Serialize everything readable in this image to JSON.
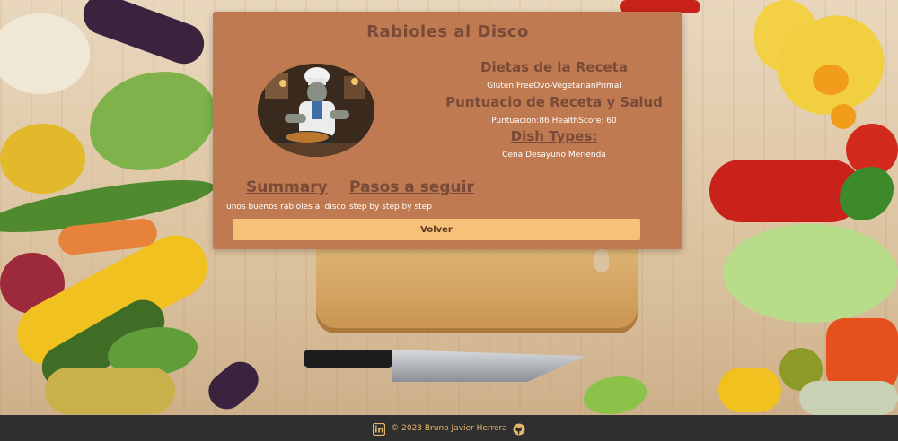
{
  "recipe": {
    "title": "Rabioles al Disco",
    "image_alt": "Chef cooking in kitchen"
  },
  "diets": {
    "heading": "Dietas de la Receta",
    "text": "Gluten FreeOvo-VegetarianPrimal"
  },
  "score": {
    "heading": "Puntuacio de Receta y Salud",
    "text": "Puntuacion:86 HealthScore: 60"
  },
  "dish_types": {
    "heading": "Dish Types:",
    "text": "Cena Desayuno Merienda"
  },
  "summary": {
    "heading": "Summary",
    "text": "unos buenos rabioles al disco"
  },
  "steps": {
    "heading": "Pasos a seguir",
    "text": "step by step by step"
  },
  "back_button": "Volver",
  "footer": {
    "text": "© 2023 Bruno Javier Herrera",
    "icons": [
      "linkedin-icon",
      "github-icon"
    ]
  },
  "colors": {
    "card": "#c07a51",
    "heading": "#7a4a38",
    "button": "#f7c179",
    "footer_bg": "#2f2f2f",
    "footer_text": "#e8b86a"
  }
}
